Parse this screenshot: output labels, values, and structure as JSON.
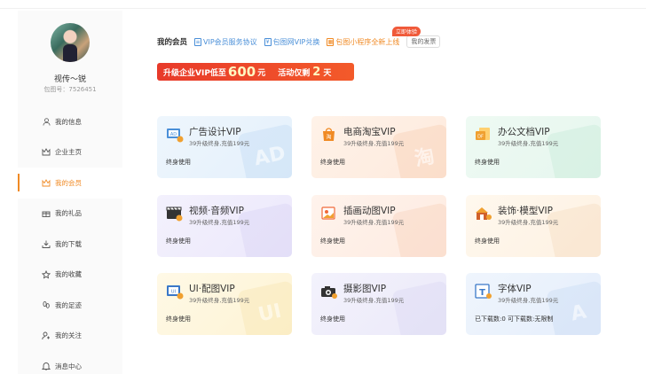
{
  "user": {
    "name": "视传～锐",
    "id_text": "包图号：7526451"
  },
  "nav": [
    {
      "label": "我的信息",
      "icon": "user-icon"
    },
    {
      "label": "企业主页",
      "icon": "crown-icon"
    },
    {
      "label": "我的会员",
      "icon": "vip-crown-icon",
      "active": true
    },
    {
      "label": "我的礼品",
      "icon": "gift-icon"
    },
    {
      "label": "我的下载",
      "icon": "download-icon"
    },
    {
      "label": "我的收藏",
      "icon": "star-icon"
    },
    {
      "label": "我的足迹",
      "icon": "footprint-icon"
    },
    {
      "label": "我的关注",
      "icon": "follow-icon"
    },
    {
      "label": "消息中心",
      "icon": "bell-icon"
    }
  ],
  "header": {
    "title": "我的会员",
    "link_agreement": "VIP会员服务协议",
    "link_exchange": "包图网VIP兑换",
    "link_miniapp": "包图小程序全新上线",
    "invoice": "我的发票",
    "badge": "立即体验"
  },
  "banner": {
    "part1": "升级企业VIP低至",
    "price": "600",
    "unit": "元",
    "part2": "活动仅剩",
    "days": "2",
    "days_unit": "天"
  },
  "cards": [
    {
      "title": "广告设计VIP",
      "sub": "39升级终身,充值199元",
      "foot": "终身使用",
      "icon": "ad-design-icon",
      "accent": "#4a8fd8",
      "deco": "AD"
    },
    {
      "title": "电商淘宝VIP",
      "sub": "39升级终身,充值199元",
      "foot": "终身使用",
      "icon": "taobao-icon",
      "accent": "#f08a24",
      "deco": "淘"
    },
    {
      "title": "办公文档VIP",
      "sub": "39升级终身,充值199元",
      "foot": "终身使用",
      "icon": "office-doc-icon",
      "accent": "#f0a030",
      "deco": ""
    },
    {
      "title": "视频·音频VIP",
      "sub": "39升级终身,充值199元",
      "foot": "终身使用",
      "icon": "video-audio-icon",
      "accent": "#333333",
      "deco": ""
    },
    {
      "title": "插画动图VIP",
      "sub": "39升级终身,充值199元",
      "foot": "终身使用",
      "icon": "illustration-icon",
      "accent": "#f06a3a",
      "deco": ""
    },
    {
      "title": "装饰·模型VIP",
      "sub": "39升级终身,充值199元",
      "foot": "终身使用",
      "icon": "decoration-model-icon",
      "accent": "#d0602a",
      "deco": ""
    },
    {
      "title": "UI·配图VIP",
      "sub": "39升级终身,充值199元",
      "foot": "终身使用",
      "icon": "ui-image-icon",
      "accent": "#3a78c8",
      "deco": "UI"
    },
    {
      "title": "摄影图VIP",
      "sub": "39升级终身,充值199元",
      "foot": "终身使用",
      "icon": "camera-icon",
      "accent": "#333333",
      "deco": ""
    },
    {
      "title": "字体VIP",
      "sub": "39升级终身,充值199元",
      "foot": "已下载数:0 可下载数:无限制",
      "icon": "font-icon",
      "accent": "#3a78c8",
      "deco": "A"
    }
  ]
}
